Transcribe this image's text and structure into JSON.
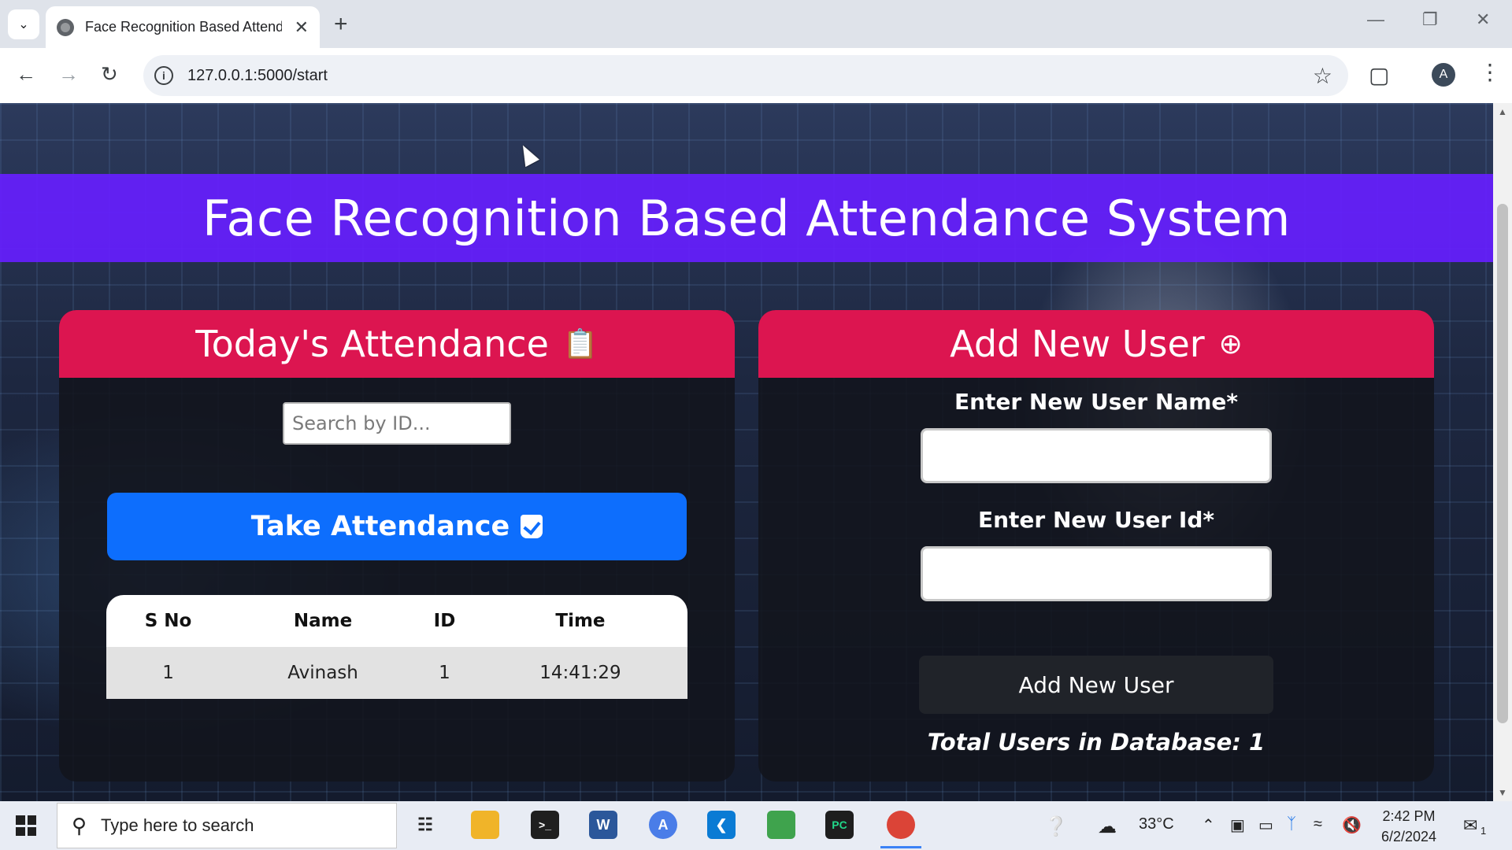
{
  "browser": {
    "tab_title": "Face Recognition Based Attendance System",
    "url": "127.0.0.1:5000/start",
    "avatar_letter": "A"
  },
  "page": {
    "banner_title": "Face Recognition Based Attendance System",
    "attendance": {
      "heading": "Today's Attendance",
      "search_placeholder": "Search by ID...",
      "take_button": "Take Attendance",
      "columns": [
        "S No",
        "Name",
        "ID",
        "Time"
      ],
      "rows": [
        {
          "sno": "1",
          "name": "Avinash",
          "id": "1",
          "time": "14:41:29"
        }
      ]
    },
    "add_user": {
      "heading": "Add New User",
      "name_label": "Enter New User Name*",
      "id_label": "Enter New User Id*",
      "button": "Add New User",
      "total": "Total Users in Database: 1"
    }
  },
  "taskbar": {
    "search_placeholder": "Type here to search",
    "temperature": "33°C",
    "time": "2:42 PM",
    "date": "6/2/2024",
    "notification_count": "1"
  },
  "colors": {
    "banner": "#661eff",
    "panel_header": "#dc1550",
    "primary_button": "#0d6efd",
    "dark_button": "#202329"
  }
}
